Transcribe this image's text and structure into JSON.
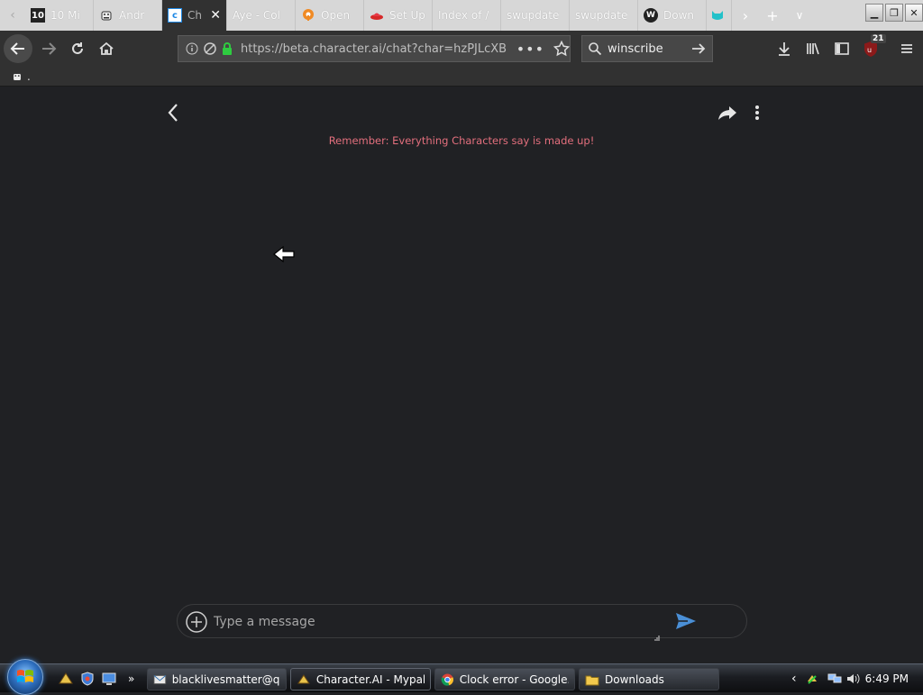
{
  "tabs": [
    {
      "label": "10 Mi",
      "icon": "ten-icon",
      "active": false
    },
    {
      "label": "Andr",
      "icon": "android-robot-icon",
      "active": false
    },
    {
      "label": "Ch",
      "icon": "character-ai-icon",
      "active": true
    },
    {
      "label": "Aye - Col",
      "icon": "",
      "active": false
    },
    {
      "label": "Open",
      "icon": "openvpn-icon",
      "active": false
    },
    {
      "label": "Set Up",
      "icon": "redhat-icon",
      "active": false
    },
    {
      "label": "Index of /",
      "icon": "",
      "active": false
    },
    {
      "label": "swupdate",
      "icon": "",
      "active": false
    },
    {
      "label": "swupdate",
      "icon": "",
      "active": false
    },
    {
      "label": "Down",
      "icon": "w-logo-icon",
      "active": false
    },
    {
      "label": "",
      "icon": "teal-cat-icon",
      "active": false
    }
  ],
  "url": "https://beta.character.ai/chat?char=hzPJLcXB",
  "search": {
    "value": "winscribe"
  },
  "ublock_badge": "21",
  "bookmarks": {
    "label": "."
  },
  "chat": {
    "disclaimer": "Remember: Everything Characters say is made up!",
    "input_placeholder": "Type a message"
  },
  "taskbar": {
    "items": [
      {
        "label": "blacklivesmatter@q...",
        "icon": "thunderbird-icon",
        "active": false
      },
      {
        "label": "Character.AI - Mypal",
        "icon": "mypal-icon",
        "active": true
      },
      {
        "label": "Clock error - Google...",
        "icon": "chrome-icon",
        "active": false
      },
      {
        "label": "Downloads",
        "icon": "folder-icon",
        "active": false
      }
    ],
    "clock": "6:49 PM"
  },
  "colors": {
    "page_bg": "#202124",
    "disclaimer": "#e36f7d",
    "send_accent": "#4a8fd6",
    "toolbar_bg": "#313131"
  }
}
